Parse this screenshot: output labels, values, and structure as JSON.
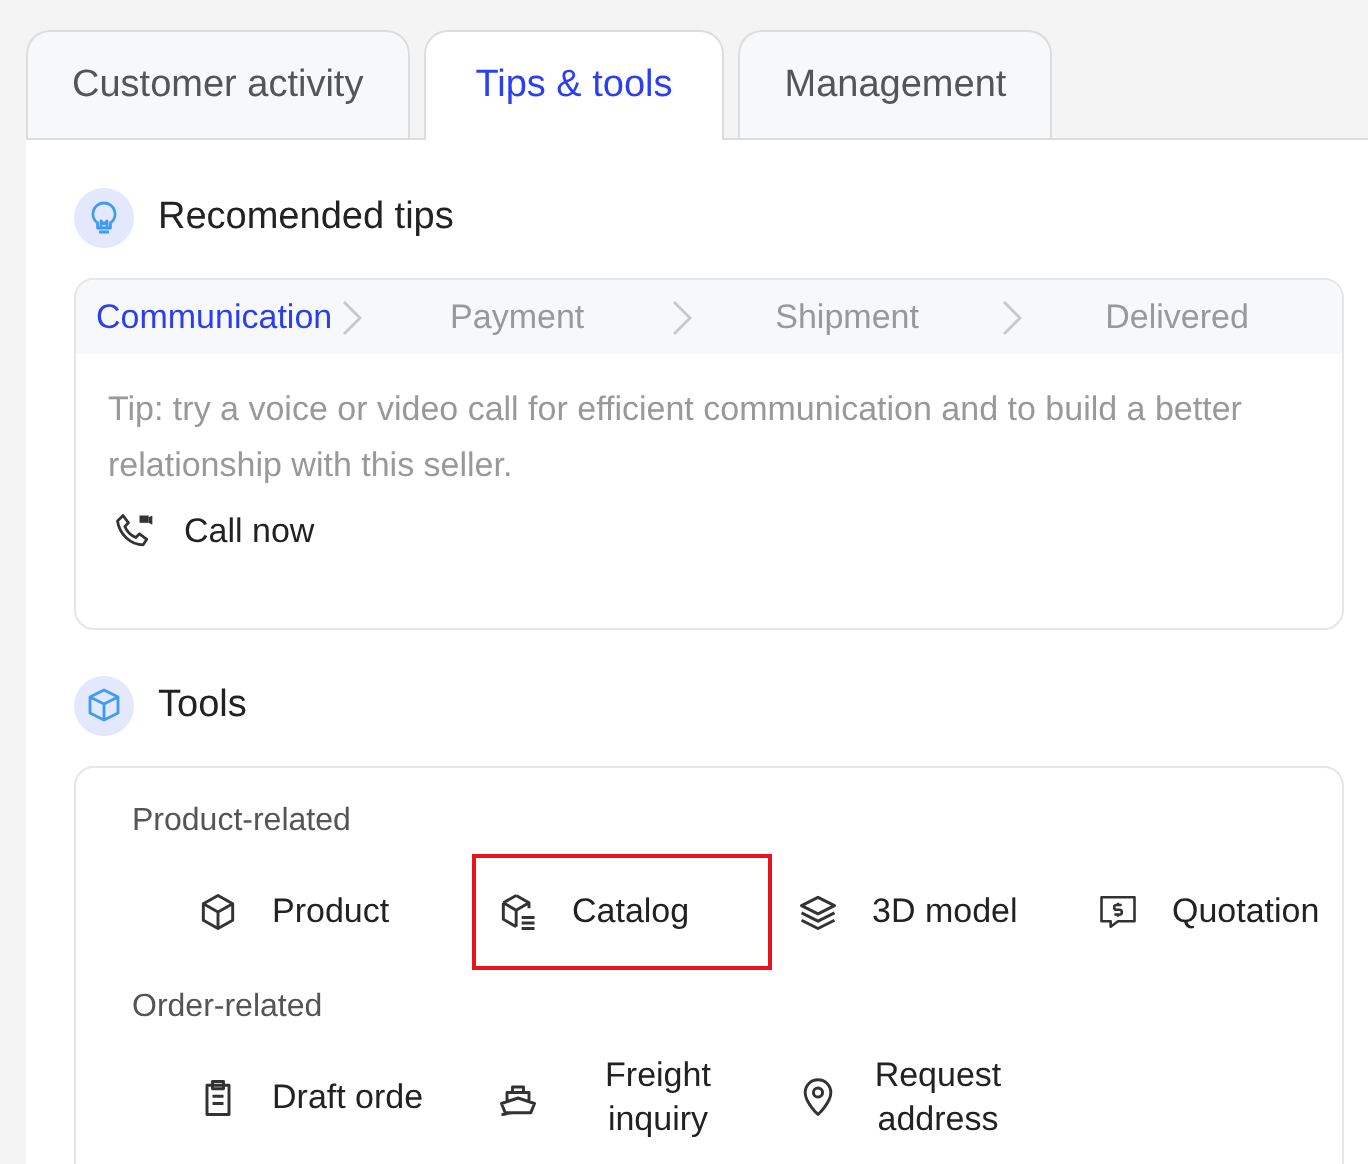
{
  "tabs": [
    {
      "label": "Customer activity",
      "selected": false
    },
    {
      "label": "Tips & tools",
      "selected": true
    },
    {
      "label": "Management",
      "selected": false
    }
  ],
  "tips": {
    "title": "Recomended tips",
    "steps": [
      {
        "label": "Communication",
        "selected": true
      },
      {
        "label": "Payment",
        "selected": false
      },
      {
        "label": "Shipment",
        "selected": false
      },
      {
        "label": "Delivered",
        "selected": false
      }
    ],
    "text": "Tip: try a voice or video call for efficient communication and to build a better relationship with this seller.",
    "action": "Call now"
  },
  "tools": {
    "title": "Tools",
    "groups": [
      {
        "label": "Product-related",
        "items": [
          {
            "kind": "box",
            "label": "Product",
            "highlighted": false
          },
          {
            "kind": "catalog",
            "label": "Catalog",
            "highlighted": true
          },
          {
            "kind": "layers",
            "label": "3D model",
            "highlighted": false
          },
          {
            "kind": "quote",
            "label": "Quotation",
            "highlighted": false
          }
        ]
      },
      {
        "label": "Order-related",
        "items": [
          {
            "kind": "clipboard",
            "label": "Draft orde",
            "highlighted": false
          },
          {
            "kind": "ship",
            "label": "Freight inquiry",
            "highlighted": false
          },
          {
            "kind": "pin",
            "label": "Request address",
            "highlighted": false
          }
        ]
      }
    ]
  }
}
